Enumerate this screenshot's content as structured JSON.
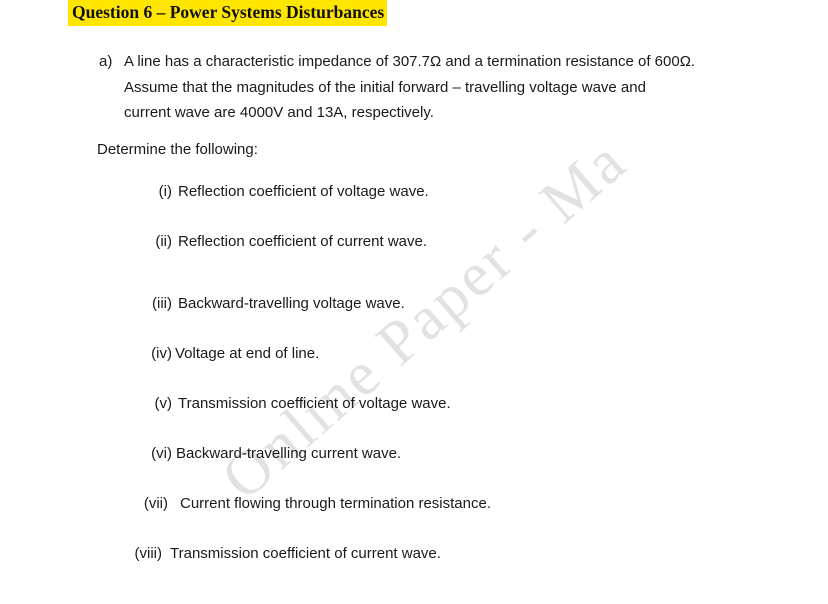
{
  "document": {
    "heading": {
      "text": "Question 6 – Power Systems Disturbances",
      "highlight_color": "#ffe600",
      "text_color": "#101010"
    },
    "part_a": {
      "label": "a)",
      "line1": "A line has a characteristic impedance of 307.7Ω and a termination resistance of 600Ω.",
      "line2": "Assume that the magnitudes of the initial forward – travelling voltage wave and",
      "line3": "current wave are 4000V and 13A, respectively."
    },
    "prompt": "Determine the following:",
    "items": [
      {
        "numeral": "(i)",
        "text": "Reflection coefficient of voltage wave."
      },
      {
        "numeral": "(ii)",
        "text": "Reflection coefficient of current wave."
      },
      {
        "numeral": "(iii)",
        "text": "Backward-travelling voltage wave."
      },
      {
        "numeral": "(iv)",
        "text": "Voltage at end of line."
      },
      {
        "numeral": "(v)",
        "text": "Transmission coefficient of voltage wave."
      },
      {
        "numeral": "(vi)",
        "text": "Backward-travelling current wave."
      },
      {
        "numeral": "(vii)",
        "text": "Current flowing through termination resistance."
      },
      {
        "numeral": "(viii)",
        "text": "Transmission coefficient of current wave."
      }
    ],
    "watermark": {
      "text": "Online Paper - Ma",
      "color": "#e2e2e2"
    }
  }
}
